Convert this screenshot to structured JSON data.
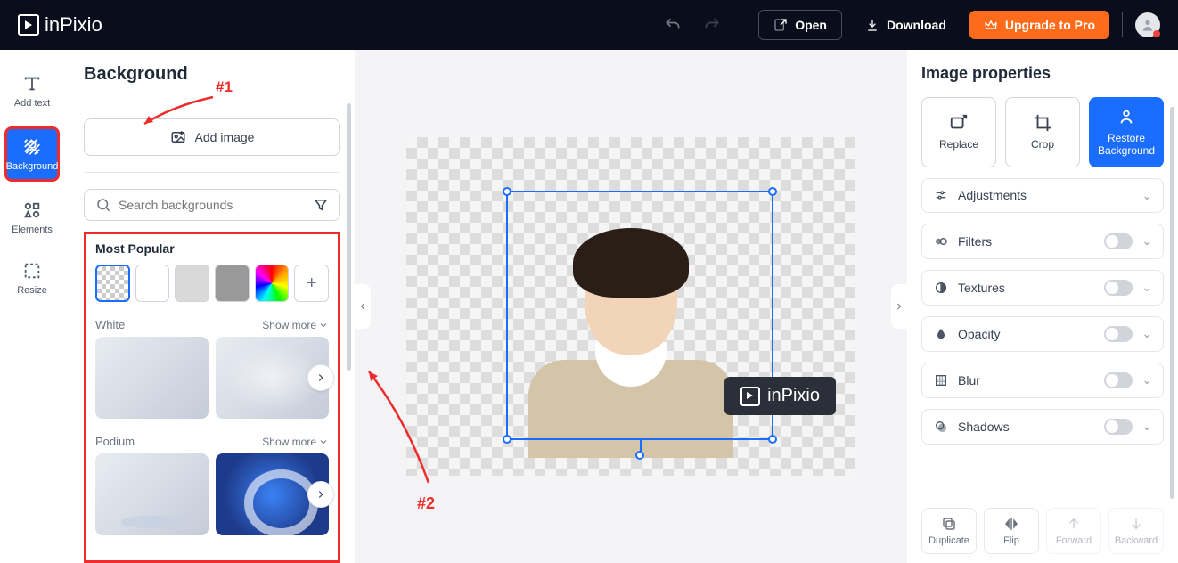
{
  "header": {
    "brand": "inPixio",
    "open_label": "Open",
    "download_label": "Download",
    "upgrade_label": "Upgrade to Pro"
  },
  "tool_rail": {
    "items": [
      {
        "id": "add-text",
        "label": "Add text"
      },
      {
        "id": "background",
        "label": "Background"
      },
      {
        "id": "elements",
        "label": "Elements"
      },
      {
        "id": "resize",
        "label": "Resize"
      }
    ]
  },
  "left_panel": {
    "title": "Background",
    "add_image_label": "Add image",
    "search_placeholder": "Search backgrounds",
    "most_popular_label": "Most Popular",
    "swatches": [
      "transparent",
      "white",
      "light-gray",
      "gray",
      "rainbow",
      "plus"
    ],
    "sections": [
      {
        "name": "White",
        "show_more": "Show more"
      },
      {
        "name": "Podium",
        "show_more": "Show more"
      }
    ]
  },
  "annotations": {
    "tag1": "#1",
    "tag2": "#2"
  },
  "canvas": {
    "watermark_text": "inPixio"
  },
  "right_panel": {
    "title": "Image properties",
    "actions": {
      "replace": "Replace",
      "crop": "Crop",
      "restore": "Restore Background"
    },
    "props": {
      "adjustments": "Adjustments",
      "filters": "Filters",
      "textures": "Textures",
      "opacity": "Opacity",
      "blur": "Blur",
      "shadows": "Shadows"
    },
    "bottom": {
      "duplicate": "Duplicate",
      "flip": "Flip",
      "forward": "Forward",
      "backward": "Backward"
    }
  }
}
